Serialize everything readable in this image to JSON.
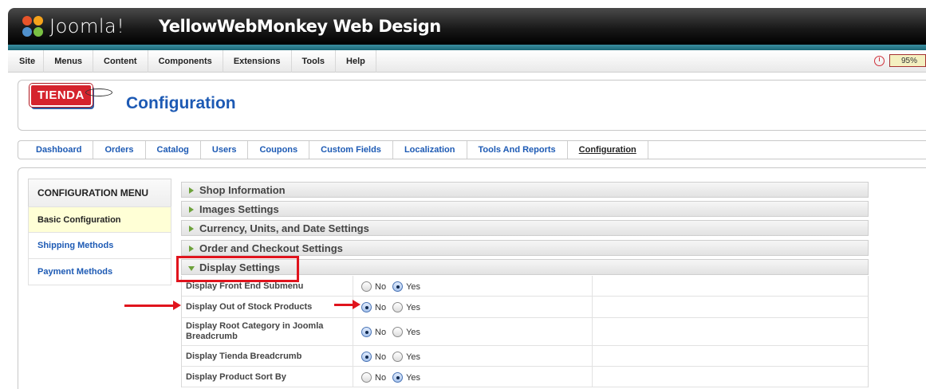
{
  "header": {
    "brand": "Joomla!",
    "site_title": "YellowWebMonkey Web Design",
    "status_percent": "95%"
  },
  "menubar": {
    "items": [
      "Site",
      "Menus",
      "Content",
      "Components",
      "Extensions",
      "Tools",
      "Help"
    ]
  },
  "component": {
    "logo_text": "TIENDA",
    "page_title": "Configuration"
  },
  "tabs": {
    "items": [
      "Dashboard",
      "Orders",
      "Catalog",
      "Users",
      "Coupons",
      "Custom Fields",
      "Localization",
      "Tools And Reports",
      "Configuration"
    ],
    "active": "Configuration"
  },
  "config_menu": {
    "title": "CONFIGURATION MENU",
    "items": [
      "Basic Configuration",
      "Shipping Methods",
      "Payment Methods"
    ],
    "selected": "Basic Configuration"
  },
  "panels": {
    "items": [
      "Shop Information",
      "Images Settings",
      "Currency, Units, and Date Settings",
      "Order and Checkout Settings",
      "Display Settings"
    ],
    "expanded": "Display Settings"
  },
  "display_settings": {
    "no_label": "No",
    "yes_label": "Yes",
    "rows": [
      {
        "label": "Display Front End Submenu",
        "value": "Yes"
      },
      {
        "label": "Display Out of Stock Products",
        "value": "No"
      },
      {
        "label": "Display Root Category in Joomla Breadcrumb",
        "value": "No"
      },
      {
        "label": "Display Tienda Breadcrumb",
        "value": "No"
      },
      {
        "label": "Display Product Sort By",
        "value": "Yes"
      }
    ]
  },
  "colors": {
    "annotation_red": "#e0141d",
    "link_blue": "#1d5ab4",
    "selected_bg": "#ffffd6"
  }
}
